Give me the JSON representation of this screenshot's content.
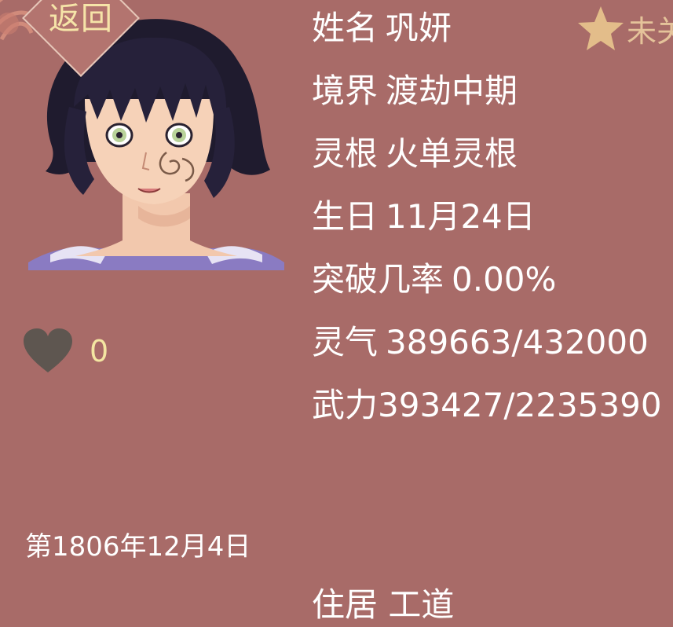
{
  "back_button": {
    "label": "返回"
  },
  "favorability": {
    "value": "0",
    "icon": "heart-icon"
  },
  "date": "第1806年12月4日",
  "status": {
    "label": "未关",
    "icon": "star-icon"
  },
  "attributes": [
    {
      "label": "姓名",
      "value": "巩妍"
    },
    {
      "label": "境界",
      "value": "渡劫中期"
    },
    {
      "label": "灵根",
      "value": "火单灵根"
    },
    {
      "label": "生日",
      "value": "11月24日"
    },
    {
      "label": "突破几率",
      "value": "0.00%"
    },
    {
      "label": "灵气",
      "value": "389663/432000"
    },
    {
      "label": "武力",
      "value": "393427/2235390"
    }
  ],
  "partial_row": "住居 工道",
  "colors": {
    "background": "#a86b68",
    "label_text": "#ffffff",
    "accent_gold": "#f4e6a2",
    "heart": "#5e5650",
    "star": "#e3bd8a"
  }
}
